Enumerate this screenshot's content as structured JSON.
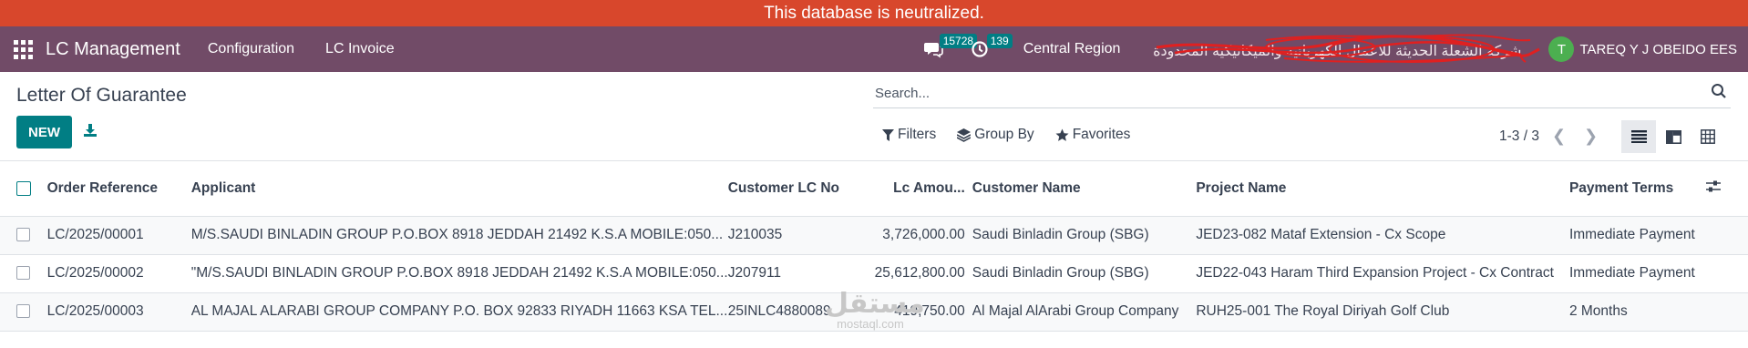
{
  "banner": {
    "text": "This database is neutralized."
  },
  "navbar": {
    "app_name": "LC Management",
    "menus": [
      "Configuration",
      "LC Invoice"
    ],
    "messages_count": "15728",
    "activities_count": "139",
    "region": "Central Region",
    "company": "شركة الشعلة الحديثة للاعمال الكهربائية والميكانيكية المحدودة",
    "user_initial": "T",
    "user_name": "TAREQ Y J OBEIDO EES"
  },
  "control_panel": {
    "title": "Letter Of Guarantee",
    "new_label": "NEW",
    "search_placeholder": "Search...",
    "filters_label": "Filters",
    "group_by_label": "Group By",
    "favorites_label": "Favorites",
    "pager": "1-3 / 3"
  },
  "table": {
    "headers": {
      "order_ref": "Order Reference",
      "applicant": "Applicant",
      "customer_lc": "Customer LC No",
      "lc_amount": "Lc Amou...",
      "customer_name": "Customer Name",
      "project_name": "Project Name",
      "payment_terms": "Payment Terms"
    },
    "rows": [
      {
        "order_ref": "LC/2025/00001",
        "applicant": "M/S.SAUDI BINLADIN GROUP P.O.BOX 8918 JEDDAH 21492 K.S.A MOBILE:050...",
        "customer_lc": "J210035",
        "lc_amount": "3,726,000.00",
        "customer_name": "Saudi Binladin Group (SBG)",
        "project_name": "JED23-082 Mataf Extension - Cx Scope",
        "payment_terms": "Immediate Payment"
      },
      {
        "order_ref": "LC/2025/00002",
        "applicant": "\"M/S.SAUDI BINLADIN GROUP P.O.BOX 8918 JEDDAH 21492 K.S.A MOBILE:050...",
        "customer_lc": "J207911",
        "lc_amount": "25,612,800.00",
        "customer_name": "Saudi Binladin Group (SBG)",
        "project_name": "JED22-043 Haram Third Expansion Project - Cx Contract",
        "payment_terms": "Immediate Payment"
      },
      {
        "order_ref": "LC/2025/00003",
        "applicant": "AL MAJAL ALARABI GROUP COMPANY P.O. BOX 92833 RIYADH 11663 KSA TEL...",
        "customer_lc": "25INLC4880089",
        "lc_amount": "419,750.00",
        "customer_name": "Al Majal AlArabi Group Company",
        "project_name": "RUH25-001 The Royal Diriyah Golf Club",
        "payment_terms": "2 Months"
      }
    ]
  },
  "watermark": {
    "arabic": "مستقل",
    "latin": "mostaql.com"
  },
  "colors": {
    "banner": "#d8472c",
    "navbar": "#714b67",
    "primary": "#017e84",
    "counter": "#017e84",
    "avatar": "#4caf50"
  }
}
